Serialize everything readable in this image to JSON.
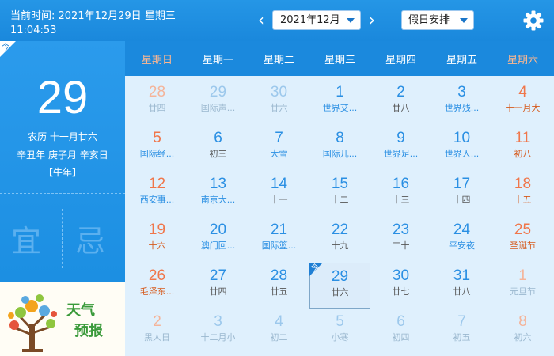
{
  "header": {
    "current_time_label": "当前时间: 2021年12月29日  星期三",
    "current_time_clock": "11:04:53",
    "prev_arrow": "‹",
    "next_arrow": "›",
    "month_select": "2021年12月",
    "holiday_select": "假日安排",
    "settings_icon": "gear-icon"
  },
  "left_panel": {
    "today_tag": "今",
    "day": "29",
    "lunar": "农历  十一月廿六",
    "ganzhi": "辛丑年  庚子月  辛亥日",
    "zodiac": "【牛年】",
    "yi": "宜",
    "ji": "忌",
    "weather_line1": "天气",
    "weather_line2": "预报",
    "weather_icon": "tree-icon"
  },
  "colors": {
    "accent": "#1b89dd",
    "weekend": "#f0764a",
    "holiday_text": "#d65a1c"
  },
  "weekdays": [
    "星期日",
    "星期一",
    "星期二",
    "星期三",
    "星期四",
    "星期五",
    "星期六"
  ],
  "weeks": [
    [
      {
        "n": "28",
        "s": "廿四",
        "type": "other"
      },
      {
        "n": "29",
        "s": "国际声...",
        "type": "other"
      },
      {
        "n": "30",
        "s": "廿六",
        "type": "other"
      },
      {
        "n": "1",
        "s": "世界艾...",
        "type": "festival"
      },
      {
        "n": "2",
        "s": "廿八",
        "type": ""
      },
      {
        "n": "3",
        "s": "世界残...",
        "type": "festival"
      },
      {
        "n": "4",
        "s": "十一月大",
        "type": "holiday"
      }
    ],
    [
      {
        "n": "5",
        "s": "国际经...",
        "type": "festival"
      },
      {
        "n": "6",
        "s": "初三",
        "type": ""
      },
      {
        "n": "7",
        "s": "大雪",
        "type": "festival"
      },
      {
        "n": "8",
        "s": "国际儿...",
        "type": "festival"
      },
      {
        "n": "9",
        "s": "世界足...",
        "type": "festival"
      },
      {
        "n": "10",
        "s": "世界人...",
        "type": "festival"
      },
      {
        "n": "11",
        "s": "初八",
        "type": "holiday"
      }
    ],
    [
      {
        "n": "12",
        "s": "西安事...",
        "type": "festival"
      },
      {
        "n": "13",
        "s": "南京大...",
        "type": "festival"
      },
      {
        "n": "14",
        "s": "十一",
        "type": ""
      },
      {
        "n": "15",
        "s": "十二",
        "type": ""
      },
      {
        "n": "16",
        "s": "十三",
        "type": ""
      },
      {
        "n": "17",
        "s": "十四",
        "type": ""
      },
      {
        "n": "18",
        "s": "十五",
        "type": "holiday"
      }
    ],
    [
      {
        "n": "19",
        "s": "十六",
        "type": "holiday"
      },
      {
        "n": "20",
        "s": "澳门回...",
        "type": "festival"
      },
      {
        "n": "21",
        "s": "国际篮...",
        "type": "festival"
      },
      {
        "n": "22",
        "s": "十九",
        "type": ""
      },
      {
        "n": "23",
        "s": "二十",
        "type": ""
      },
      {
        "n": "24",
        "s": "平安夜",
        "type": "festival"
      },
      {
        "n": "25",
        "s": "圣诞节",
        "type": "holiday"
      }
    ],
    [
      {
        "n": "26",
        "s": "毛泽东...",
        "type": "holiday"
      },
      {
        "n": "27",
        "s": "廿四",
        "type": ""
      },
      {
        "n": "28",
        "s": "廿五",
        "type": ""
      },
      {
        "n": "29",
        "s": "廿六",
        "type": "today"
      },
      {
        "n": "30",
        "s": "廿七",
        "type": ""
      },
      {
        "n": "31",
        "s": "廿八",
        "type": ""
      },
      {
        "n": "1",
        "s": "元旦节",
        "type": "other-holiday"
      }
    ],
    [
      {
        "n": "2",
        "s": "黑人日",
        "type": "other-festival"
      },
      {
        "n": "3",
        "s": "十二月小",
        "type": "other"
      },
      {
        "n": "4",
        "s": "初二",
        "type": "other"
      },
      {
        "n": "5",
        "s": "小寒",
        "type": "other-festival"
      },
      {
        "n": "6",
        "s": "初四",
        "type": "other"
      },
      {
        "n": "7",
        "s": "初五",
        "type": "other"
      },
      {
        "n": "8",
        "s": "初六",
        "type": "other"
      }
    ]
  ]
}
